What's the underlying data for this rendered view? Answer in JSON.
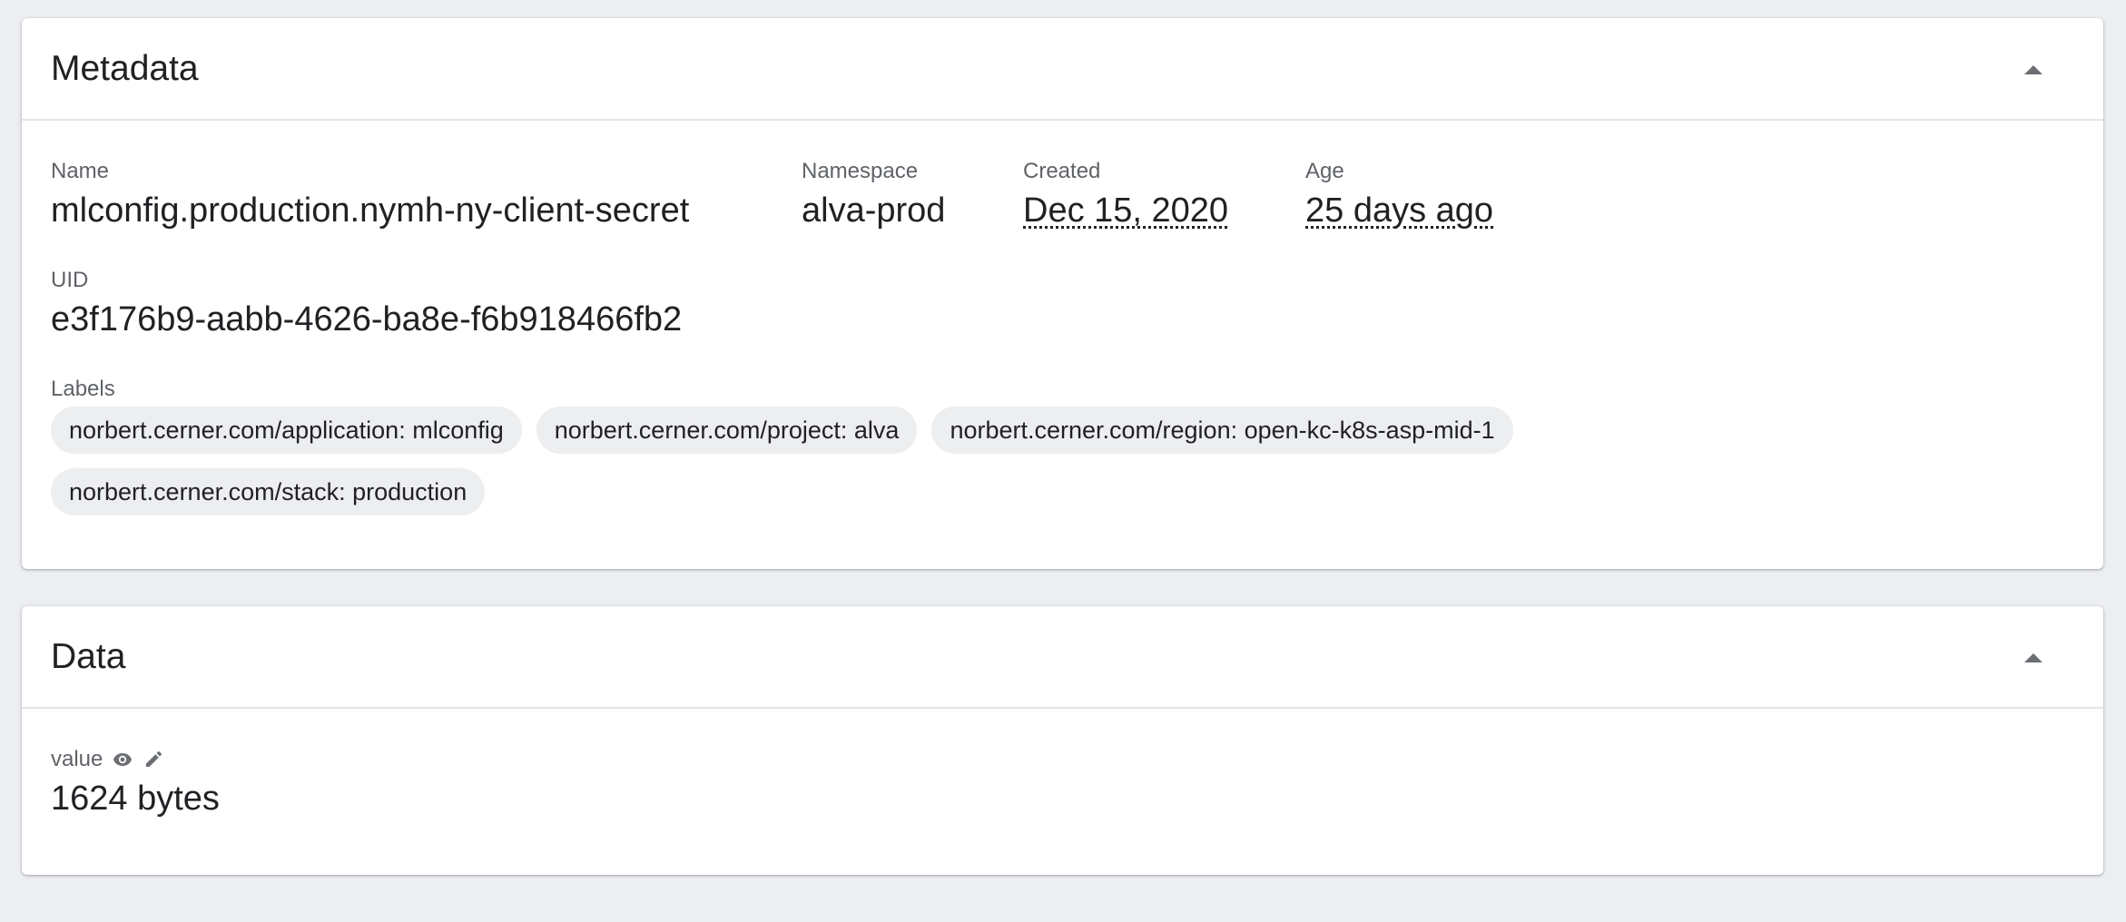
{
  "metadata": {
    "title": "Metadata",
    "name_label": "Name",
    "name_value": "mlconfig.production.nymh-ny-client-secret",
    "namespace_label": "Namespace",
    "namespace_value": "alva-prod",
    "created_label": "Created",
    "created_value": "Dec 15, 2020",
    "age_label": "Age",
    "age_value": "25 days ago",
    "uid_label": "UID",
    "uid_value": "e3f176b9-aabb-4626-ba8e-f6b918466fb2",
    "labels_label": "Labels",
    "labels": [
      "norbert.cerner.com/application: mlconfig",
      "norbert.cerner.com/project: alva",
      "norbert.cerner.com/region: open-kc-k8s-asp-mid-1",
      "norbert.cerner.com/stack: production"
    ],
    "collapse_icon": "chevron-up-icon"
  },
  "data": {
    "title": "Data",
    "value_label": "value",
    "value_value": "1624 bytes",
    "reveal_icon": "eye-icon",
    "edit_icon": "pencil-icon",
    "collapse_icon": "chevron-up-icon"
  },
  "colors": {
    "background": "#eceef1",
    "card": "#ffffff",
    "chip": "#edeef0",
    "label_text": "#5f6368",
    "value_text": "#202124"
  }
}
